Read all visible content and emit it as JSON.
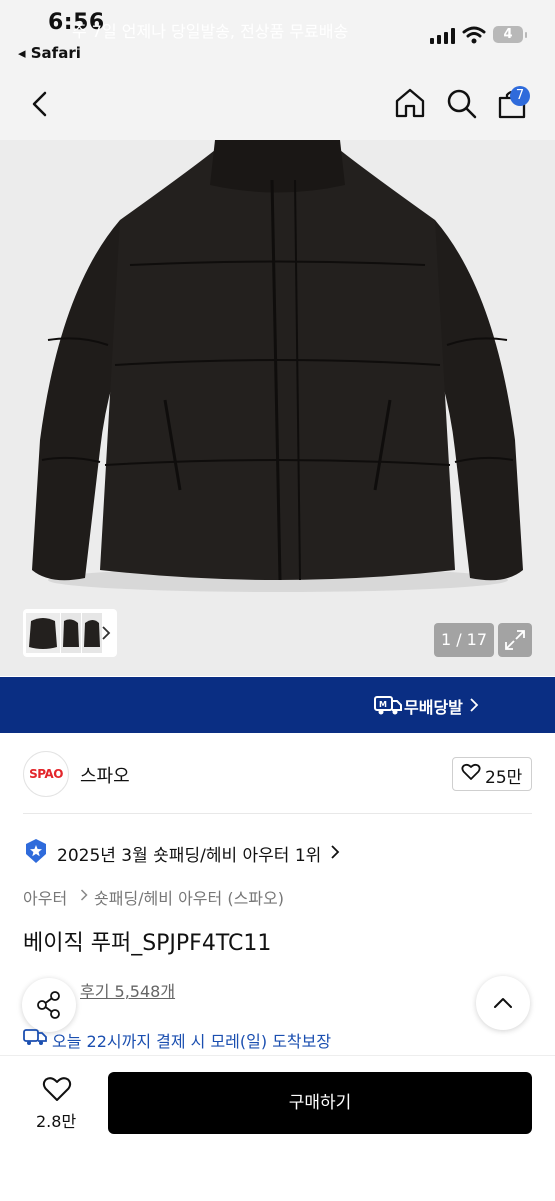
{
  "status_bar": {
    "time": "6:56",
    "back_app": "◂ Safari",
    "battery": "4"
  },
  "nav": {
    "cart_count": "7"
  },
  "gallery": {
    "counter": "1 / 17"
  },
  "banner": {
    "text": "주 7일 언제나 당일발송, 전상품 무료배송",
    "logo_text": "무배당발"
  },
  "brand": {
    "logo_text": "SPAO",
    "name": "스파오",
    "likes": "25만"
  },
  "ranking": {
    "text": "2025년 3월 숏패딩/헤비 아우터 1위"
  },
  "breadcrumb": {
    "level1": "아우터",
    "level2": "숏패딩/헤비 아우터 (스파오)"
  },
  "product": {
    "title": "베이직 푸퍼_SPJPF4TC11",
    "review_text": "후기 5,548개"
  },
  "delivery": {
    "text": "오늘 22시까지 결제 시 모레(일) 도착보장"
  },
  "bottom_bar": {
    "wish_count": "2.8만",
    "buy_label": "구매하기"
  },
  "colors": {
    "banner_bg": "#0a2e83",
    "accent_blue": "#2f6bdb",
    "buy_bg": "#000000"
  },
  "icons": [
    "back-icon",
    "home-icon",
    "search-icon",
    "cart-icon",
    "chevron-right-icon",
    "expand-icon",
    "heart-icon",
    "share-icon",
    "chevron-up-icon",
    "ranking-badge-icon",
    "delivery-truck-icon"
  ]
}
